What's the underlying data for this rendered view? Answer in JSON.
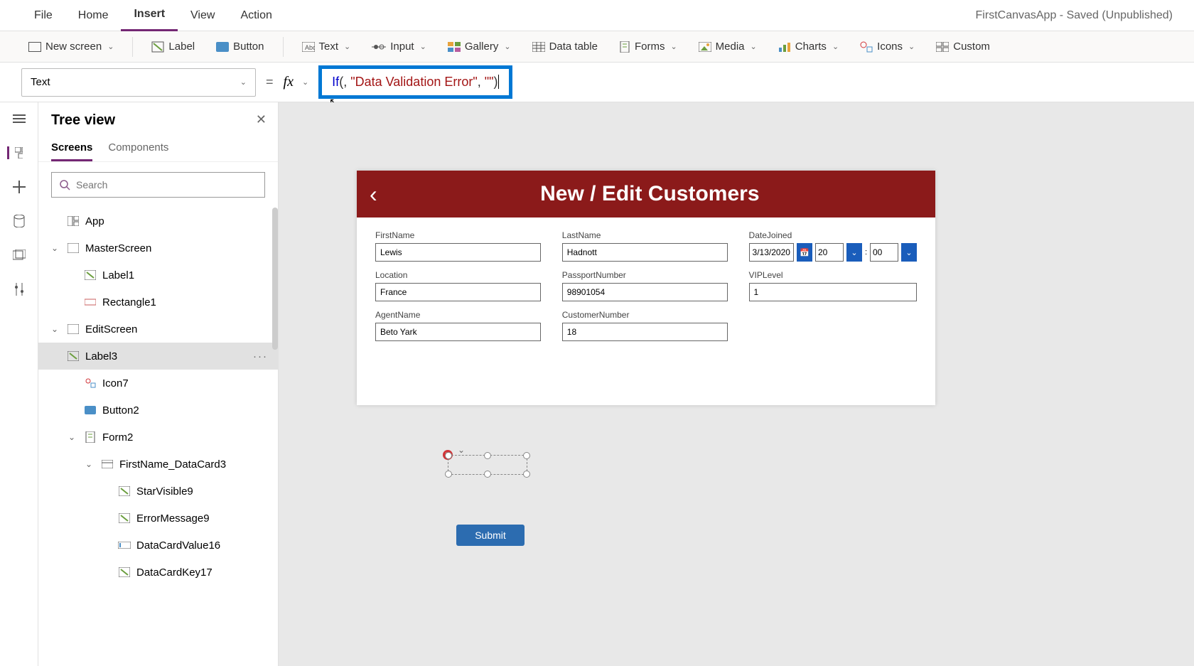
{
  "appTitle": "FirstCanvasApp - Saved (Unpublished)",
  "menu": {
    "items": [
      "File",
      "Home",
      "Insert",
      "View",
      "Action"
    ],
    "activeIndex": 2
  },
  "ribbon": {
    "newScreen": "New screen",
    "label": "Label",
    "button": "Button",
    "text": "Text",
    "input": "Input",
    "gallery": "Gallery",
    "dataTable": "Data table",
    "forms": "Forms",
    "media": "Media",
    "charts": "Charts",
    "icons": "Icons",
    "custom": "Custom"
  },
  "formulaBar": {
    "property": "Text",
    "fx": "fx",
    "equals": "=",
    "formula": {
      "fn": "If",
      "open": "(",
      "comma1": ", ",
      "str1": "\"Data Validation Error\"",
      "comma2": ", ",
      "str2": "\"\"",
      "close": ")"
    }
  },
  "treePanel": {
    "title": "Tree view",
    "tabs": [
      "Screens",
      "Components"
    ],
    "activeTab": 0,
    "searchPlaceholder": "Search",
    "nodes": [
      {
        "label": "App",
        "indent": 1,
        "icon": "app"
      },
      {
        "label": "MasterScreen",
        "indent": 1,
        "icon": "screen",
        "toggle": "down"
      },
      {
        "label": "Label1",
        "indent": 2,
        "icon": "label"
      },
      {
        "label": "Rectangle1",
        "indent": 2,
        "icon": "rect"
      },
      {
        "label": "EditScreen",
        "indent": 1,
        "icon": "screen",
        "toggle": "down"
      },
      {
        "label": "Label3",
        "indent": 2,
        "icon": "label",
        "selected": true
      },
      {
        "label": "Icon7",
        "indent": 2,
        "icon": "icon"
      },
      {
        "label": "Button2",
        "indent": 2,
        "icon": "button"
      },
      {
        "label": "Form2",
        "indent": 2,
        "icon": "form",
        "toggle": "down"
      },
      {
        "label": "FirstName_DataCard3",
        "indent": 3,
        "icon": "card",
        "toggle": "down"
      },
      {
        "label": "StarVisible9",
        "indent": 4,
        "icon": "label"
      },
      {
        "label": "ErrorMessage9",
        "indent": 4,
        "icon": "label"
      },
      {
        "label": "DataCardValue16",
        "indent": 4,
        "icon": "input"
      },
      {
        "label": "DataCardKey17",
        "indent": 4,
        "icon": "label"
      }
    ]
  },
  "canvas": {
    "headerTitle": "New / Edit Customers",
    "fields": {
      "firstName": {
        "label": "FirstName",
        "value": "Lewis"
      },
      "lastName": {
        "label": "LastName",
        "value": "Hadnott"
      },
      "dateJoined": {
        "label": "DateJoined",
        "date": "3/13/2020",
        "hour": "20",
        "sep": ":",
        "min": "00"
      },
      "location": {
        "label": "Location",
        "value": "France"
      },
      "passport": {
        "label": "PassportNumber",
        "value": "98901054"
      },
      "vip": {
        "label": "VIPLevel",
        "value": "1"
      },
      "agent": {
        "label": "AgentName",
        "value": "Beto Yark"
      },
      "custNum": {
        "label": "CustomerNumber",
        "value": "18"
      }
    },
    "submit": "Submit"
  }
}
